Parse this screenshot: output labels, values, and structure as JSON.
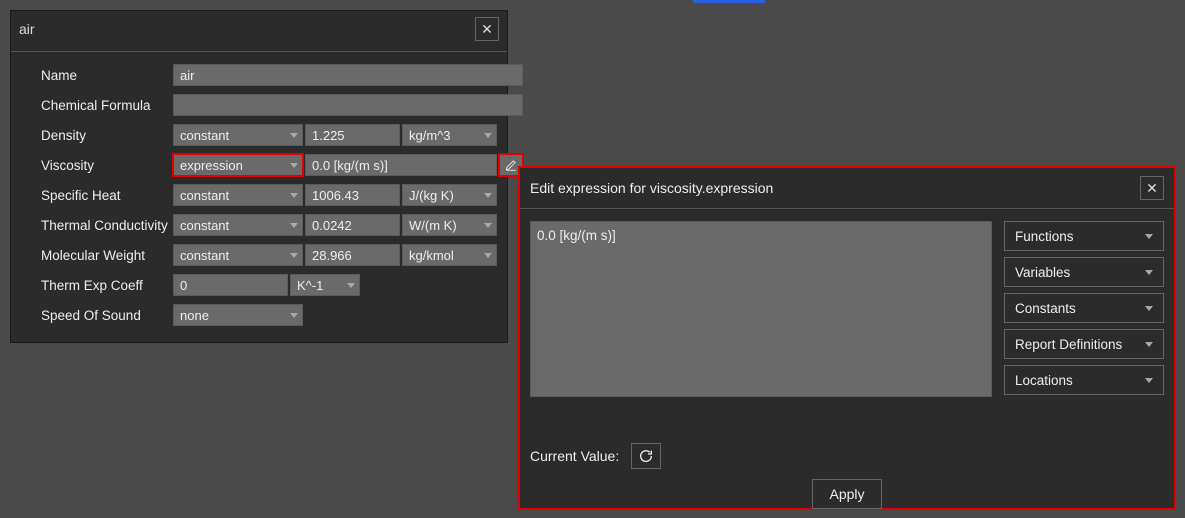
{
  "leftPanel": {
    "title": "air",
    "rows": {
      "name": {
        "label": "Name",
        "value": "air"
      },
      "chemicalFormula": {
        "label": "Chemical Formula",
        "value": ""
      },
      "density": {
        "label": "Density",
        "mode": "constant",
        "value": "1.225",
        "unit": "kg/m^3"
      },
      "viscosity": {
        "label": "Viscosity",
        "mode": "expression",
        "value": "0.0 [kg/(m s)]"
      },
      "specificHeat": {
        "label": "Specific Heat",
        "mode": "constant",
        "value": "1006.43",
        "unit": "J/(kg K)"
      },
      "thermalCond": {
        "label": "Thermal Conductivity",
        "mode": "constant",
        "value": "0.0242",
        "unit": "W/(m K)"
      },
      "molecularWeight": {
        "label": "Molecular Weight",
        "mode": "constant",
        "value": "28.966",
        "unit": "kg/kmol"
      },
      "thermExpCoeff": {
        "label": "Therm Exp Coeff",
        "value": "0",
        "unit": "K^-1"
      },
      "speedOfSound": {
        "label": "Speed Of Sound",
        "mode": "none"
      }
    }
  },
  "rightPanel": {
    "title": "Edit expression for viscosity.expression",
    "expression": "0.0 [kg/(m s)]",
    "dropdowns": [
      "Functions",
      "Variables",
      "Constants",
      "Report Definitions",
      "Locations"
    ],
    "currentValueLabel": "Current Value:",
    "applyLabel": "Apply"
  }
}
